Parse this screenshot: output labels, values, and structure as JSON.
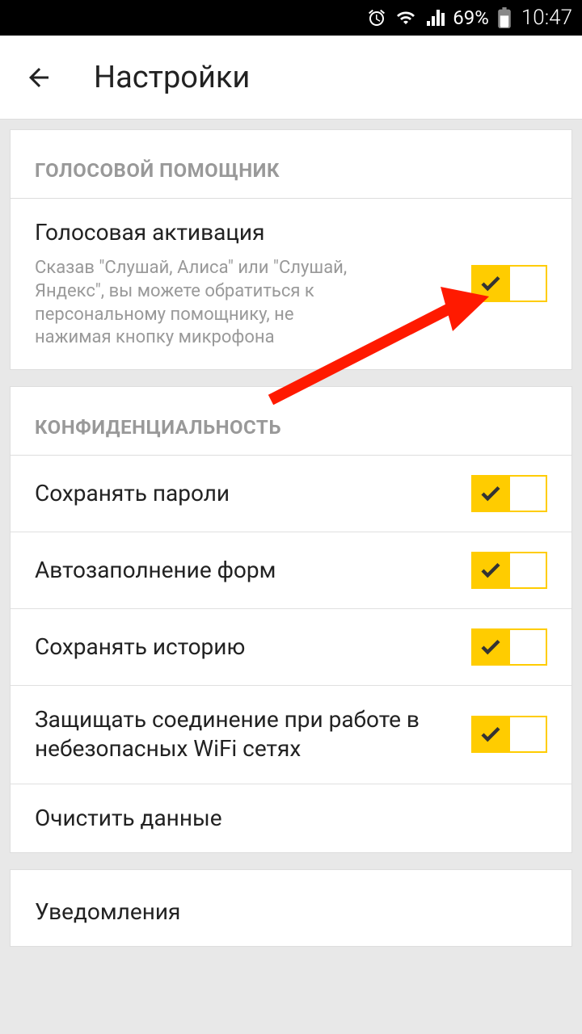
{
  "statusbar": {
    "battery": "69%",
    "time": "10:47"
  },
  "appbar": {
    "title": "Настройки"
  },
  "sections": [
    {
      "header": "ГОЛОСОВОЙ ПОМОЩНИК",
      "items": [
        {
          "label": "Голосовая активация",
          "desc": "Сказав \"Слушай, Алиса\" или \"Слушай, Яндекс\", вы можете обратиться к персональному помощнику, не нажимая кнопку микрофона",
          "toggle": true
        }
      ]
    },
    {
      "header": "КОНФИДЕНЦИАЛЬНОСТЬ",
      "items": [
        {
          "label": "Сохранять пароли",
          "toggle": true
        },
        {
          "label": "Автозаполнение форм",
          "toggle": true
        },
        {
          "label": "Сохранять историю",
          "toggle": true
        },
        {
          "label": "Защищать соединение при работе в небезопасных WiFi сетях",
          "toggle": true
        },
        {
          "label": "Очистить данные"
        }
      ]
    },
    {
      "header": "",
      "items": [
        {
          "label": "Уведомления"
        }
      ]
    }
  ]
}
